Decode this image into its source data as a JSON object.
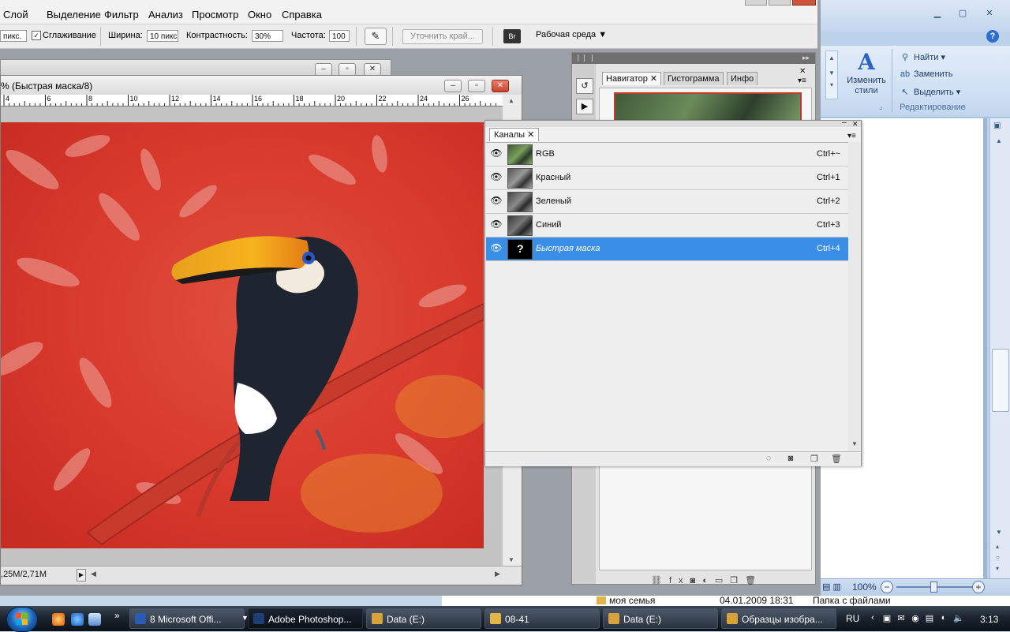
{
  "photoshop": {
    "menu": [
      "Слой",
      "Выделение",
      "Фильтр",
      "Анализ",
      "Просмотр",
      "Окно",
      "Справка"
    ],
    "options": {
      "feather_value": "пикс.",
      "smoothing_label": "Сглаживание",
      "smoothing_checked": true,
      "width_label": "Ширина:",
      "width_value": "10 пикс",
      "contrast_label": "Контрастность:",
      "contrast_value": "30%",
      "frequency_label": "Частота:",
      "frequency_value": "100",
      "refine_edge": "Уточнить край...",
      "workspace": "Рабочая среда"
    },
    "document": {
      "title": "% (Быстрая маска/8)",
      "ruler_labels": [
        "4",
        "6",
        "8",
        "10",
        "12",
        "14",
        "16",
        "18",
        "20",
        "22",
        "24",
        "26"
      ],
      "status": ",25M/2,71M"
    },
    "navigator": {
      "tabs": [
        "Навигатор",
        "Гистограмма",
        "Инфо"
      ]
    },
    "channels": {
      "tab": "Каналы",
      "rows": [
        {
          "name": "RGB",
          "shortcut": "Ctrl+~",
          "selected": false
        },
        {
          "name": "Красный",
          "shortcut": "Ctrl+1",
          "selected": false
        },
        {
          "name": "Зеленый",
          "shortcut": "Ctrl+2",
          "selected": false
        },
        {
          "name": "Синий",
          "shortcut": "Ctrl+3",
          "selected": false
        },
        {
          "name": "Быстрая маска",
          "shortcut": "Ctrl+4",
          "selected": true
        }
      ]
    }
  },
  "word": {
    "styles_button": "Изменить стили",
    "find": "Найти",
    "replace": "Заменить",
    "select": "Выделить",
    "group_label": "Редактирование",
    "zoom": "100%"
  },
  "explorer": {
    "name": "моя семья",
    "date": "04.01.2009 18:31",
    "type": "Папка с файлами"
  },
  "taskbar": {
    "buttons": [
      {
        "label": "8 Microsoft Offi...",
        "color": "#2b5cb3",
        "active": false
      },
      {
        "label": "Adobe Photoshop...",
        "color": "#1e3f73",
        "active": true
      },
      {
        "label": "Data (E:)",
        "color": "#d8a23a",
        "active": false
      },
      {
        "label": "08-41",
        "color": "#e0b54a",
        "active": false
      },
      {
        "label": "Data (E:)",
        "color": "#d8a23a",
        "active": false
      },
      {
        "label": "Образцы изобра...",
        "color": "#d8a23a",
        "active": false
      }
    ],
    "language": "RU",
    "clock": "3:13"
  }
}
